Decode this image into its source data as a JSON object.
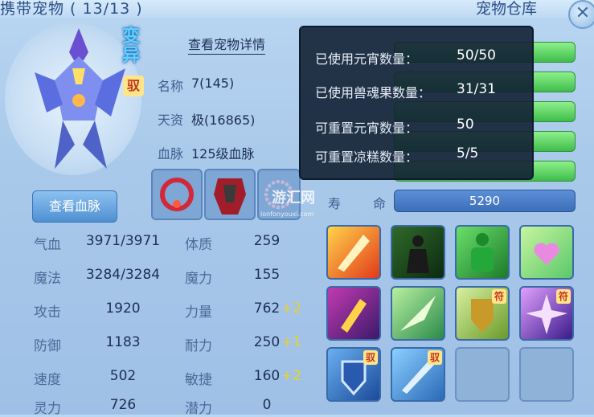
{
  "window": {
    "title": "携带宠物 ( 13/13 )",
    "right_tab": "宠物仓库",
    "close_glyph": "✕"
  },
  "pet": {
    "mutation_label": "变异",
    "badge": "驭",
    "detail_link": "查看宠物详情",
    "name_label": "名称",
    "name_value": "7(145)",
    "aptitude_label": "天资",
    "aptitude_value": "极(16865)",
    "bloodline_label": "血脉",
    "bloodline_value": "125级血脉",
    "bloodline_button": "查看血脉"
  },
  "stats": [
    {
      "label": "气血",
      "value": "3971/3971",
      "label2": "体质",
      "value2": "259",
      "bonus2": ""
    },
    {
      "label": "魔法",
      "value": "3284/3284",
      "label2": "魔力",
      "value2": "155",
      "bonus2": ""
    },
    {
      "label": "攻击",
      "value": "1920",
      "label2": "力量",
      "value2": "762",
      "bonus2": "+2"
    },
    {
      "label": "防御",
      "value": "1183",
      "label2": "耐力",
      "value2": "250",
      "bonus2": "+1"
    },
    {
      "label": "速度",
      "value": "502",
      "label2": "敏捷",
      "value2": "160",
      "bonus2": "+2"
    },
    {
      "label": "灵力",
      "value": "726",
      "label2": "潜力",
      "value2": "0",
      "bonus2": ""
    }
  ],
  "life": {
    "label_a": "寿",
    "label_b": "命",
    "value": "5290"
  },
  "tooltip": [
    {
      "label": "已使用元宵数量：",
      "value": "50/50"
    },
    {
      "label": "已使用兽魂果数量：",
      "value": "31/31"
    },
    {
      "label": "可重置元宵数量：",
      "value": "50"
    },
    {
      "label": "可重置凉糕数量：",
      "value": "5/5"
    }
  ],
  "skills": {
    "row1": [
      "sword-skill-icon",
      "shadow-warrior-skill-icon",
      "green-giant-skill-icon",
      "heart-skill-icon"
    ],
    "row2": [
      "golden-blade-skill-icon",
      "green-burst-skill-icon",
      "shield-talisman-skill-icon",
      "purple-burst-skill-icon"
    ],
    "row3": [
      "blue-shield-skill-icon",
      "blue-slash-skill-icon"
    ],
    "tags": {
      "fu": "符",
      "yu": "驭"
    }
  },
  "watermark": {
    "main": "游汇网",
    "sub": "lonfonyouxi.com"
  },
  "colors": {
    "green_bar": "#3fbd4c",
    "accent": "#2a4f86",
    "bonus": "#e8d12a"
  }
}
